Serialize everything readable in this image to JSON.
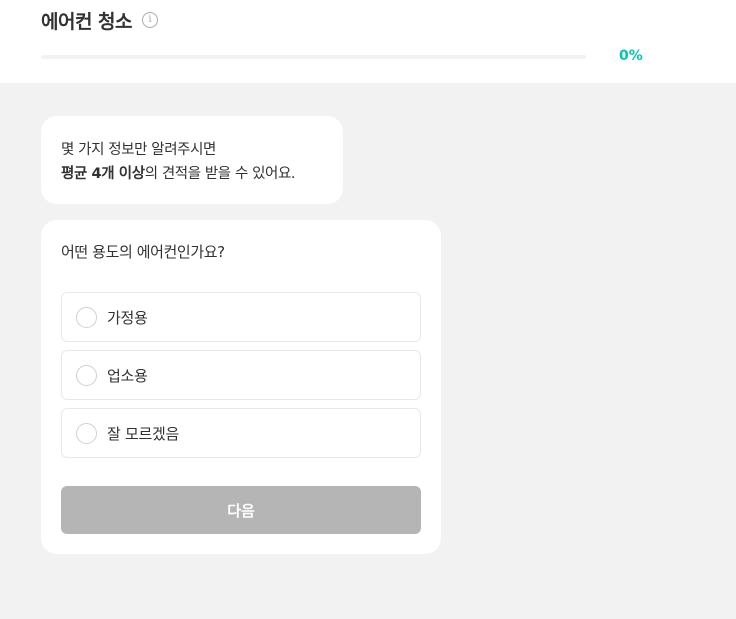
{
  "header": {
    "title": "에어컨 청소",
    "info_icon": "info-icon",
    "progress_value": 0,
    "progress_text": "0%"
  },
  "intro": {
    "line1": "몇 가지 정보만 알려주시면",
    "line2_bold": "평균 4개 이상",
    "line2_rest": "의 견적을 받을 수 있어요."
  },
  "question": {
    "text": "어떤 용도의 에어컨인가요?",
    "options": [
      {
        "label": "가정용"
      },
      {
        "label": "업소용"
      },
      {
        "label": "잘 모르겠음"
      }
    ],
    "next_label": "다음"
  },
  "colors": {
    "accent": "#00c7ae",
    "button_disabled": "#b5b5b5",
    "background": "#f2f2f2"
  }
}
